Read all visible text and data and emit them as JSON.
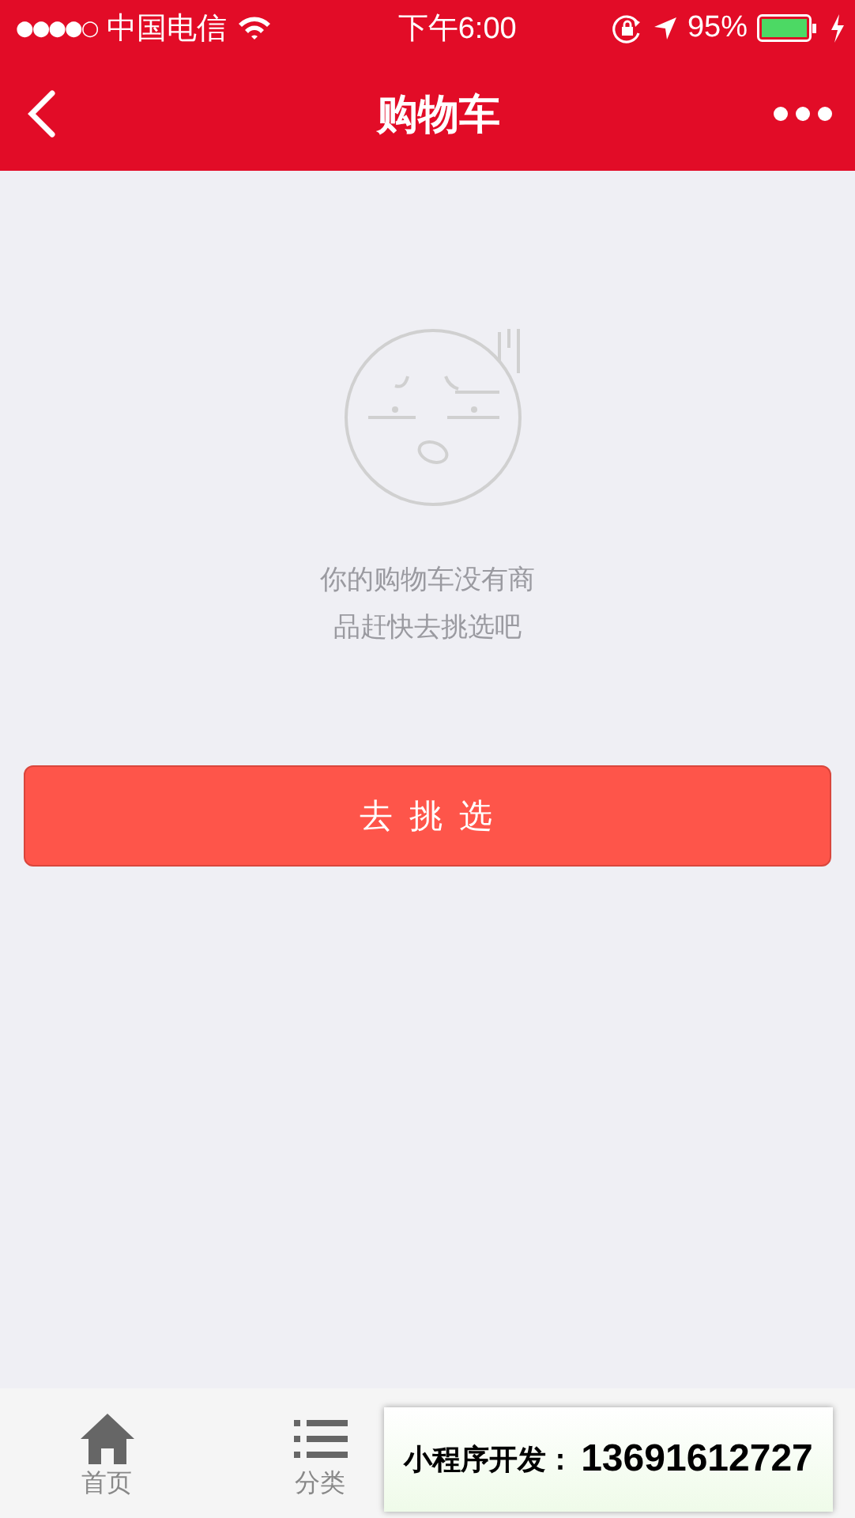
{
  "status_bar": {
    "signal": "●●●●○",
    "carrier": "中国电信",
    "time": "下午6:00",
    "battery": "95%"
  },
  "nav": {
    "title": "购物车"
  },
  "empty": {
    "message": "你的购物车没有商品赶快去挑选吧",
    "button": "去 挑 选"
  },
  "tabs": [
    {
      "label": "首页",
      "kind": "home",
      "selected": false
    },
    {
      "label": "分类",
      "kind": "list",
      "selected": false
    }
  ],
  "contact_banner": {
    "label": "小程序开发：",
    "phone": "13691612727"
  }
}
